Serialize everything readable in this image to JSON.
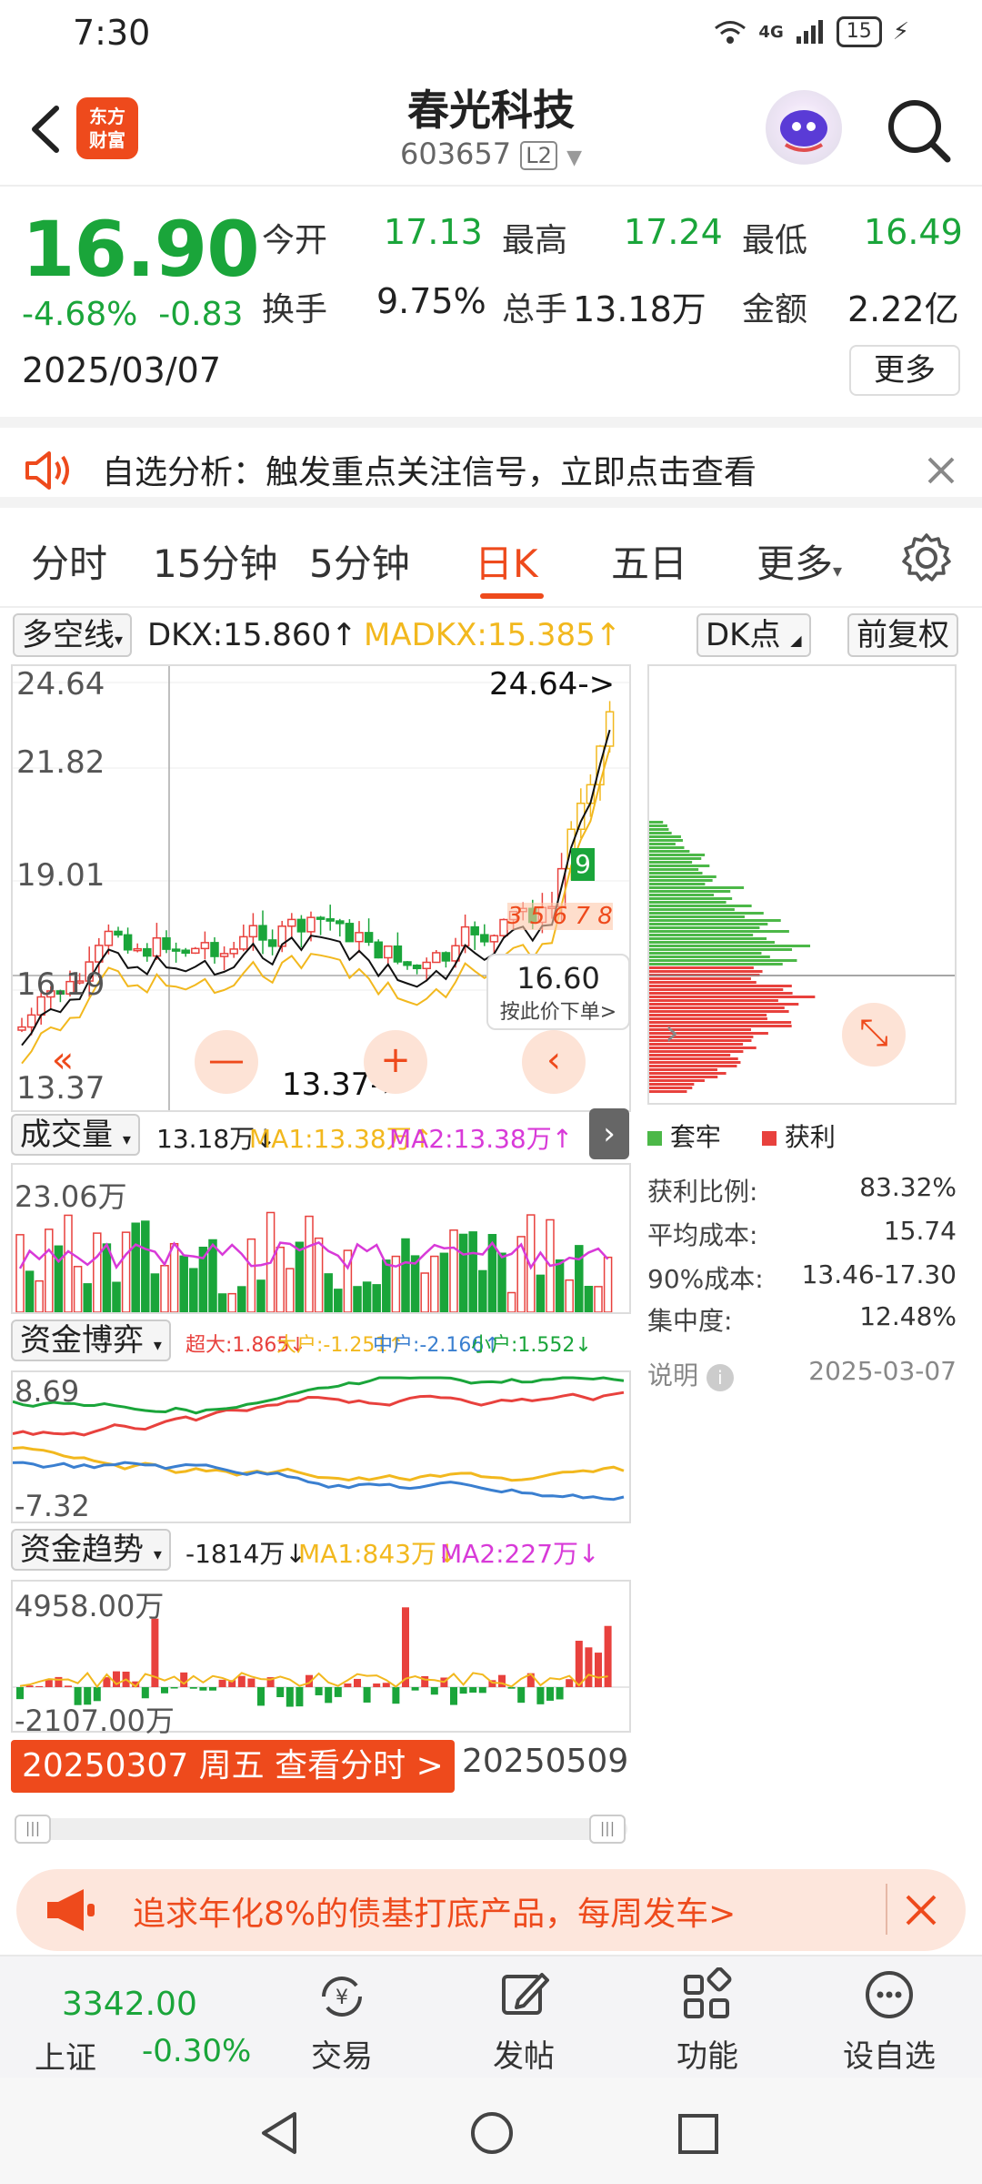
{
  "status_bar": {
    "time": "7:30",
    "network": "4G",
    "battery": "15"
  },
  "header": {
    "title": "春光科技",
    "code": "603657",
    "level": "L2",
    "logo_text_1": "东方",
    "logo_text_2": "财富"
  },
  "quote": {
    "price": "16.90",
    "change_pct": "-4.68%",
    "change": "-0.83",
    "date": "2025/03/07",
    "open_label": "今开",
    "open": "17.13",
    "high_label": "最高",
    "high": "17.24",
    "low_label": "最低",
    "low": "16.49",
    "turnover_label": "换手",
    "turnover": "9.75%",
    "volume_label": "总手",
    "volume": "13.18万",
    "amount_label": "金额",
    "amount": "2.22亿",
    "more_label": "更多"
  },
  "alert": {
    "text": "自选分析：触发重点关注信号，立即点击查看"
  },
  "tabs": [
    {
      "label": "分时"
    },
    {
      "label": "15分钟"
    },
    {
      "label": "5分钟"
    },
    {
      "label": "日K"
    },
    {
      "label": "五日"
    },
    {
      "label": "更多"
    }
  ],
  "main_chart": {
    "indicator": "多空线",
    "dkx": "DKX:15.860↑",
    "madkx": "MADKX:15.385↑",
    "dk_point": "DK点",
    "adjust": "前复权",
    "axis_labels": [
      "24.64",
      "21.82",
      "19.01",
      "16.19",
      "13.37"
    ],
    "high_mark": "24.64->",
    "low_mark": "13.37->",
    "popup_price": "16.60",
    "popup_hint": "按此价下单>",
    "signal_9": "9",
    "signal_seq": "3 5 6 7 8"
  },
  "chip": {
    "legend_trapped": "套牢",
    "legend_profit": "获利",
    "rows": [
      {
        "label": "获利比例:",
        "value": "83.32%"
      },
      {
        "label": "平均成本:",
        "value": "15.74"
      },
      {
        "label": "90%成本:",
        "value": "13.46-17.30"
      },
      {
        "label": "集中度:",
        "value": "12.48%"
      }
    ],
    "note_label": "说明",
    "note_date": "2025-03-07"
  },
  "volume_panel": {
    "label": "成交量",
    "value": "13.18万↓",
    "ma1": "MA1:13.38万↑",
    "ma2": "MA2:13.38万↑",
    "max": "23.06万"
  },
  "fund_panel": {
    "label": "资金博弈",
    "super": "超大:1.865↓",
    "big": "大户:-1.251↑",
    "mid": "中户:-2.166↑",
    "small": "小户:1.552↓",
    "max": "8.69",
    "min": "-7.32"
  },
  "trend_panel": {
    "label": "资金趋势",
    "value": "-1814万↓",
    "ma1": "MA1:843万↓",
    "ma2": "MA2:227万↓",
    "max": "4958.00万",
    "min": "-2107.00万"
  },
  "date_bar": {
    "current": "20250307 周五 查看分时 >",
    "end": "20250509"
  },
  "banner": {
    "text": "追求年化8%的债基打底产品，每周发车>"
  },
  "bottom_nav": {
    "index_value": "3342.00",
    "index_name": "上证",
    "index_change": "-0.30%",
    "items": [
      {
        "label": "交易"
      },
      {
        "label": "发帖"
      },
      {
        "label": "功能"
      },
      {
        "label": "设自选"
      }
    ]
  },
  "colors": {
    "up": "#e8413d",
    "down": "#1aa53a",
    "accent": "#ee4a1c",
    "yellow": "#f2b81e",
    "magenta": "#d83ad8"
  }
}
